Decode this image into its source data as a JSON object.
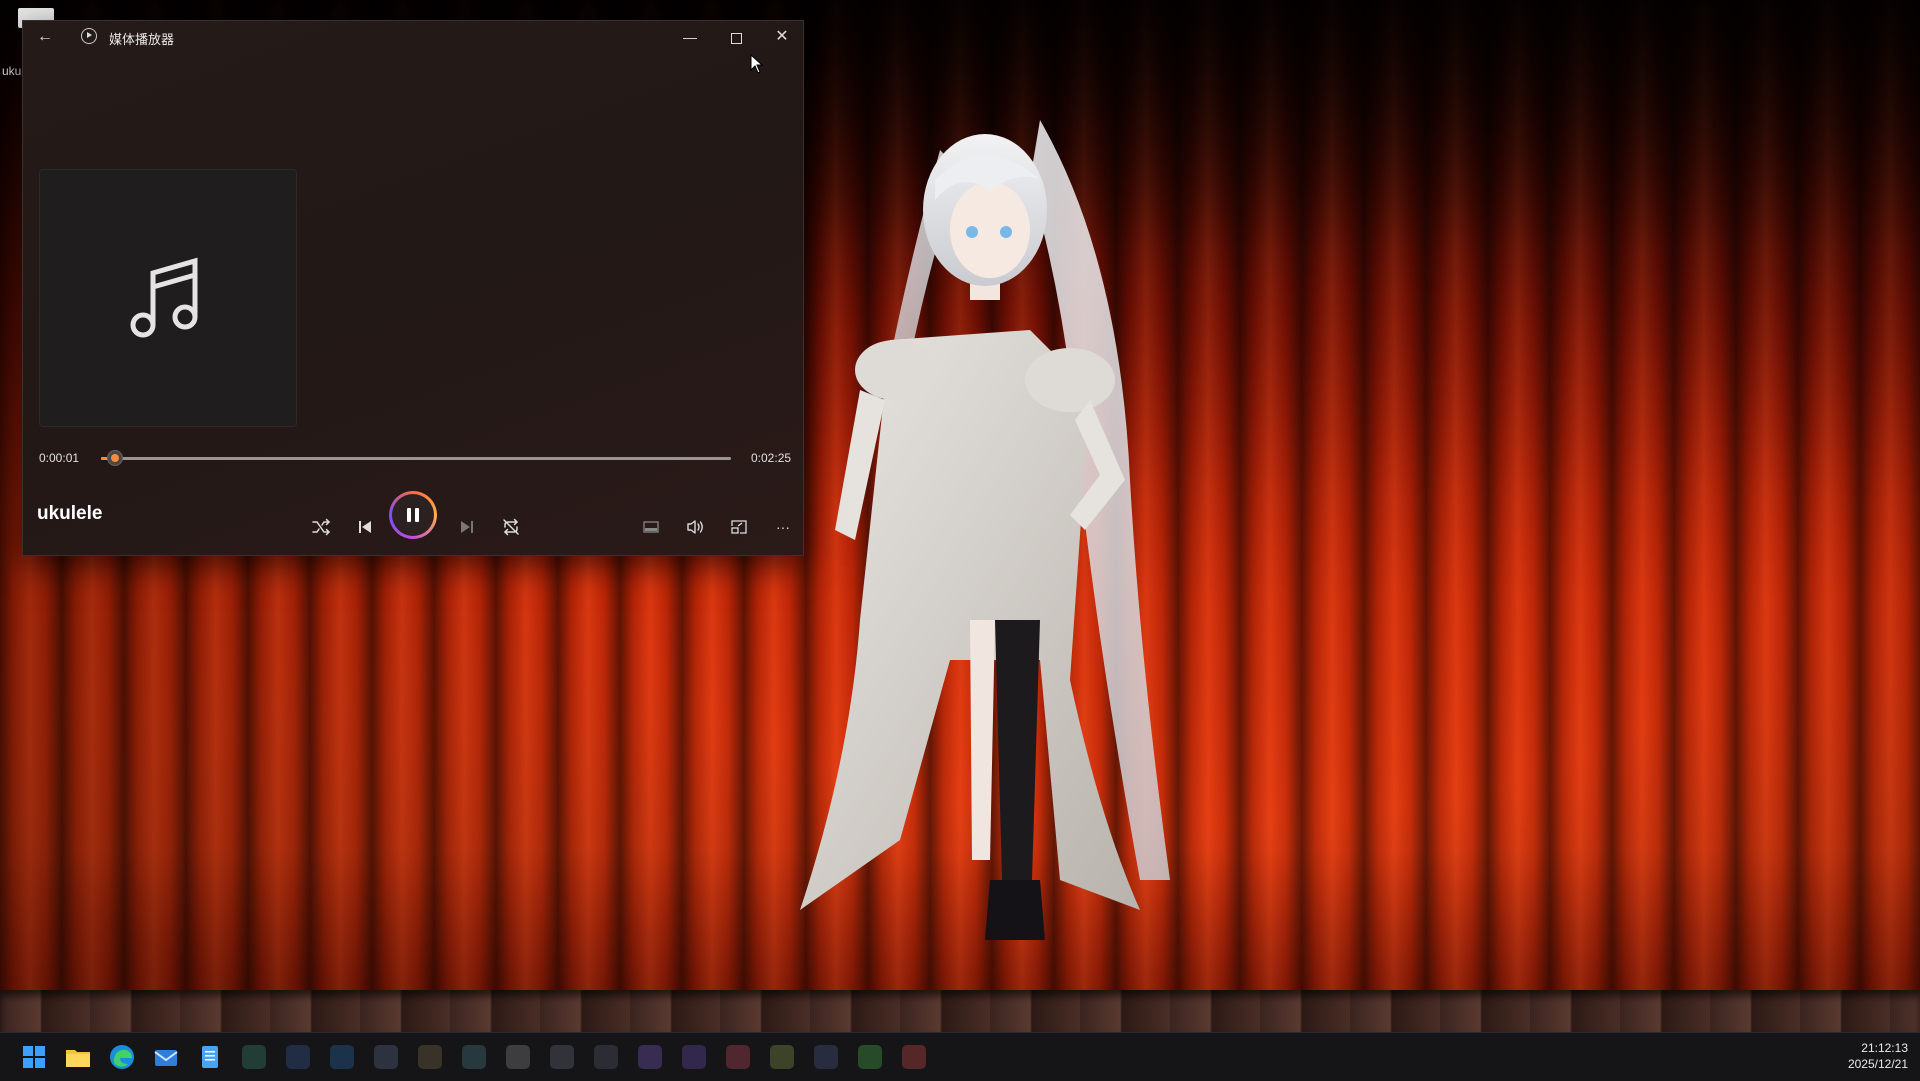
{
  "desktop": {
    "file_label": "uku"
  },
  "player": {
    "window_title": "媒体播放器",
    "buttons": {
      "back": "←",
      "minimize": "—",
      "close": "✕"
    },
    "album_art_icon": "music-note-icon",
    "time_elapsed": "0:00:01",
    "time_total": "0:02:25",
    "progress_fraction": 0.007,
    "track_title": "ukulele",
    "state": "playing",
    "controls": [
      "shuffle-icon",
      "previous-icon",
      "pause-icon",
      "next-icon",
      "repeat-off-icon",
      "miniplayer-icon",
      "volume-icon",
      "cast-icon",
      "more-icon"
    ],
    "more_label": "···"
  },
  "taskbar": {
    "apps": [
      "windows-start-icon",
      "file-explorer-icon",
      "edge-icon",
      "mail-icon",
      "notepad-icon"
    ],
    "clock_time": "21:12:13",
    "clock_date": "2025/12/21"
  },
  "colors": {
    "accent": "#ff8a3c",
    "curtain": "#d22a08",
    "window_bg": "#241a18"
  }
}
